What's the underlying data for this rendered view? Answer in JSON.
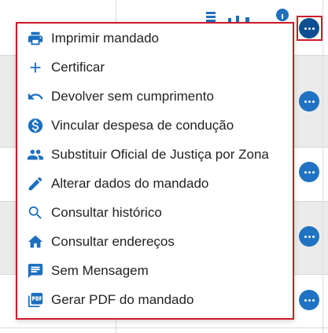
{
  "colors": {
    "accent": "#1f73c2",
    "accent_dark": "#0d4f91",
    "highlight": "#d0192b",
    "icon": "#1d6fbf",
    "row_alt": "#ebebeb"
  },
  "menu": {
    "items": [
      {
        "label": "Imprimir mandado",
        "icon": "printer-icon"
      },
      {
        "label": "Certificar",
        "icon": "plus-icon"
      },
      {
        "label": "Devolver sem cumprimento",
        "icon": "undo-icon"
      },
      {
        "label": "Vincular despesa de condução",
        "icon": "dollar-icon"
      },
      {
        "label": "Substituir Oficial de Justiça por Zona",
        "icon": "people-icon"
      },
      {
        "label": "Alterar dados do mandado",
        "icon": "pencil-icon"
      },
      {
        "label": "Consultar histórico",
        "icon": "search-icon"
      },
      {
        "label": "Consultar endereços",
        "icon": "home-icon"
      },
      {
        "label": "Sem Mensagem",
        "icon": "message-icon"
      },
      {
        "label": "Gerar PDF do mandado",
        "icon": "pdf-icon"
      }
    ]
  }
}
